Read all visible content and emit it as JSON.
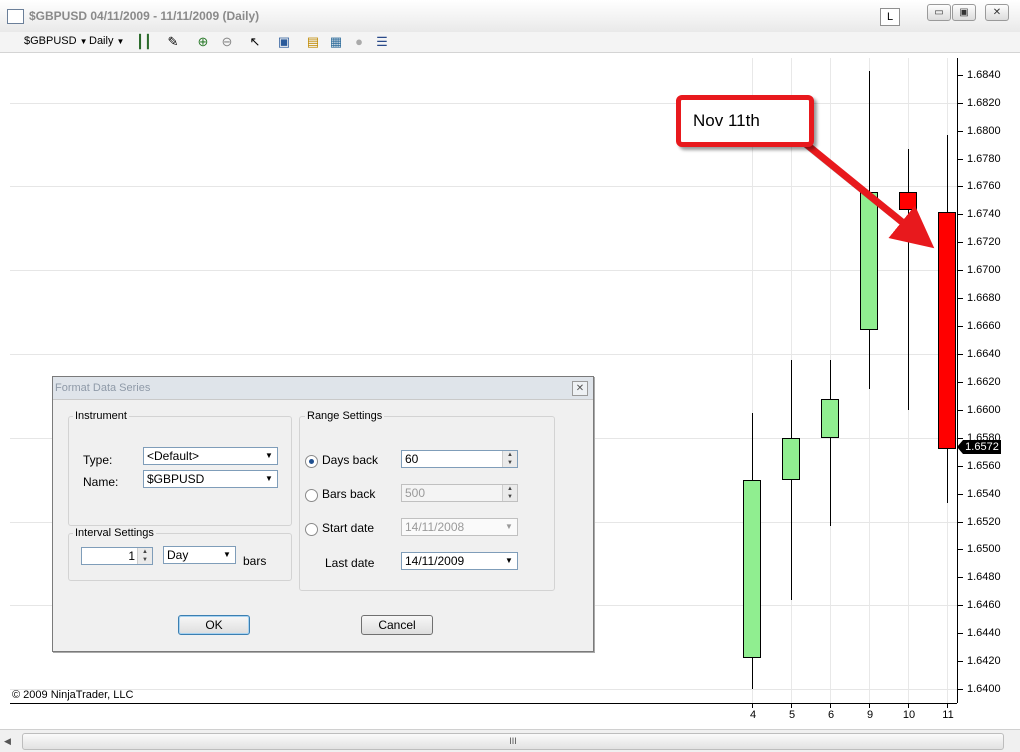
{
  "window": {
    "title": "$GBPUSD  04/11/2009 - 11/11/2009 (Daily)",
    "link_button_label": "L",
    "minimize_glyph": "▭",
    "restore_glyph": "▣",
    "close_glyph": "✕"
  },
  "toolbar": {
    "instrument_label": "$GBPUSD",
    "period_label": "Daily",
    "icons": [
      "candlestick-icon",
      "pencil-icon",
      "zoom-in-icon",
      "zoom-out-icon",
      "cursor-icon",
      "snapshot-icon",
      "data-series-icon",
      "indicators-icon",
      "strategy-icon",
      "properties-icon"
    ]
  },
  "chart_data": {
    "type": "candlestick",
    "title": "",
    "categories": [
      "4",
      "5",
      "6",
      "9",
      "10",
      "11"
    ],
    "ohlc": [
      {
        "x": "4",
        "open": 1.6422,
        "high": 1.6598,
        "low": 1.64,
        "close": 1.655
      },
      {
        "x": "5",
        "open": 1.655,
        "high": 1.6636,
        "low": 1.6464,
        "close": 1.658
      },
      {
        "x": "6",
        "open": 1.658,
        "high": 1.6636,
        "low": 1.6517,
        "close": 1.6608
      },
      {
        "x": "9",
        "open": 1.6657,
        "high": 1.6843,
        "low": 1.6615,
        "close": 1.6756
      },
      {
        "x": "10",
        "open": 1.6756,
        "high": 1.6787,
        "low": 1.66,
        "close": 1.6743
      },
      {
        "x": "11",
        "open": 1.6742,
        "high": 1.6797,
        "low": 1.6533,
        "close": 1.6572
      }
    ],
    "ylim": [
      1.639,
      1.6852
    ],
    "ytick_labels": [
      "1.6840",
      "1.6820",
      "1.6800",
      "1.6780",
      "1.6760",
      "1.6740",
      "1.6720",
      "1.6700",
      "1.6680",
      "1.6660",
      "1.6640",
      "1.6620",
      "1.6600",
      "1.6580",
      "1.6560",
      "1.6540",
      "1.6520",
      "1.6500",
      "1.6480",
      "1.6460",
      "1.6440",
      "1.6420",
      "1.6400"
    ],
    "last_price_label": "1.6572",
    "up_color": "#90ee90",
    "down_color": "#ff0000",
    "annotation": "Nov 11th",
    "copyright": "© 2009 NinjaTrader, LLC",
    "grid": true
  },
  "dialog": {
    "title": "Format Data Series",
    "instrument_group": "Instrument",
    "type_label": "Type:",
    "type_value": "<Default>",
    "name_label": "Name:",
    "name_value": "$GBPUSD",
    "interval_group": "Interval Settings",
    "interval_value": "1",
    "interval_unit": "Day",
    "bars_label": "bars",
    "range_group": "Range Settings",
    "days_back_label": "Days back",
    "days_back_value": "60",
    "bars_back_label": "Bars back",
    "bars_back_value": "500",
    "start_date_label": "Start date",
    "start_date_value": "14/11/2008",
    "last_date_label": "Last date",
    "last_date_value": "14/11/2009",
    "selected_range": "Days back",
    "ok_label": "OK",
    "cancel_label": "Cancel"
  },
  "scrollbar": {
    "grip": "III"
  }
}
